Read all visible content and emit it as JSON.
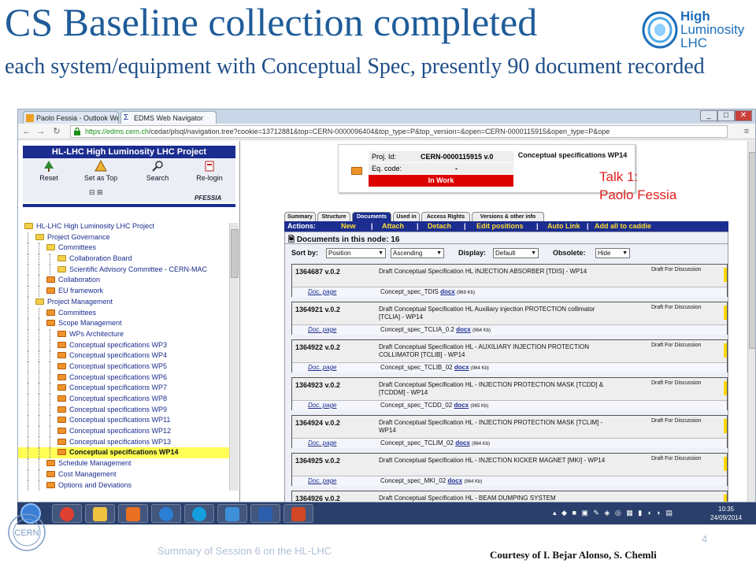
{
  "slide": {
    "title": "CS Baseline collection completed",
    "subtitle": "each system/equipment with Conceptual Spec, presently 90 document recorded",
    "logo_lines": [
      "High",
      "Luminosity",
      "LHC"
    ],
    "talk_line1": "Talk 1:",
    "talk_line2": "Paolo Fessia",
    "footer_left": "Summary of Session 6 on the HL-LHC",
    "page_number": "4",
    "courtesy": "Courtesy of  I. Bejar Alonso, S. Chemli"
  },
  "browser": {
    "tabs": [
      "Paolo Fessia - Outlook We",
      "EDMS Web Navigator"
    ],
    "url_host": "https://edms.cern.ch",
    "url_path": "/cedar/plsql/navigation.tree?cookie=13712881&top=CERN-0000096404&top_type=P&top_version=&open=CERN-0000115915&open_type=P&ope"
  },
  "left": {
    "header": "HL-LHC High Luminosity LHC Project",
    "tools": [
      "Reset",
      "Set as Top",
      "Search",
      "Re-login"
    ],
    "user": "PFESSIA",
    "tree": [
      {
        "label": "HL-LHC High Luminosity LHC Project",
        "color": "y",
        "indent": 0
      },
      {
        "label": "Project Governance",
        "color": "y",
        "indent": 1
      },
      {
        "label": "Committees",
        "color": "y",
        "indent": 2
      },
      {
        "label": "Collaboration Board",
        "color": "y",
        "indent": 3
      },
      {
        "label": "Scientific Advisory Committee - CERN-MAC",
        "color": "y",
        "indent": 3
      },
      {
        "label": "Collaboration",
        "color": "o",
        "indent": 2
      },
      {
        "label": "EU framework",
        "color": "o",
        "indent": 2
      },
      {
        "label": "Project Management",
        "color": "y",
        "indent": 1
      },
      {
        "label": "Committees",
        "color": "o",
        "indent": 2
      },
      {
        "label": "Scope Management",
        "color": "o",
        "indent": 2
      },
      {
        "label": "WPs Architecture",
        "color": "o",
        "indent": 3
      },
      {
        "label": "Conceptual specifications WP3",
        "color": "o",
        "indent": 3
      },
      {
        "label": "Conceptual specifications WP4",
        "color": "o",
        "indent": 3
      },
      {
        "label": "Conceptual specifications WP5",
        "color": "o",
        "indent": 3
      },
      {
        "label": "Conceptual specifications WP6",
        "color": "o",
        "indent": 3
      },
      {
        "label": "Conceptual specifications WP7",
        "color": "o",
        "indent": 3
      },
      {
        "label": "Conceptual specifications WP8",
        "color": "o",
        "indent": 3
      },
      {
        "label": "Conceptual specifications WP9",
        "color": "o",
        "indent": 3
      },
      {
        "label": "Conceptual specifications WP11",
        "color": "o",
        "indent": 3
      },
      {
        "label": "Conceptual specifications WP12",
        "color": "o",
        "indent": 3
      },
      {
        "label": "Conceptual specifications WP13",
        "color": "o",
        "indent": 3
      },
      {
        "label": "Conceptual specifications WP14",
        "color": "o",
        "indent": 3,
        "selected": true
      },
      {
        "label": "Schedule Management",
        "color": "o",
        "indent": 2
      },
      {
        "label": "Cost Management",
        "color": "o",
        "indent": 2
      },
      {
        "label": "Options and Deviations",
        "color": "o",
        "indent": 2
      }
    ]
  },
  "right": {
    "proj_id_label": "Proj. Id:",
    "proj_id_value": "CERN-0000115915  v.0",
    "eq_code_label": "Eq. code:",
    "eq_code_value": "-",
    "status": "In Work",
    "node_title": "Conceptual specifications WP14",
    "doc_tabs": [
      "Summary",
      "Structure",
      "Documents",
      "Used in",
      "Access Rights",
      "Versions & other info"
    ],
    "actions_label": "Actions:",
    "actions": [
      "New",
      "Attach",
      "Detach",
      "Edit positions",
      "Auto Link",
      "Add all to caddie"
    ],
    "docs_header": "Documents in this node: 16",
    "sort_by_label": "Sort by:",
    "sort_by_value": "Position",
    "sort_order_value": "Ascending",
    "display_label": "Display:",
    "display_value": "Default",
    "obsolete_label": "Obsolete:",
    "obsolete_value": "Hide",
    "documents": [
      {
        "id": "1364687 v.0.2",
        "title": "Draft Conceptual Specification HL INJECTION ABSORBER [TDIS] - WP14",
        "status": "Draft For Discussion",
        "file": "Concept_spec_TDIS",
        "size": "(969 Kb)"
      },
      {
        "id": "1364921 v.0.2",
        "title": "Draft Conceptual Specification HL Auxiliary injection PROTECTION collimator [TCLIA] - WP14",
        "status": "Draft For Discussion",
        "file": "Concept_spec_TCLIA_0.2",
        "size": "(964 Kb)"
      },
      {
        "id": "1364922 v.0.2",
        "title": "Draft Conceptual Specification HL - AUXILIARY INJECTION PROTECTION COLLIMATOR [TCLIB] - WP14",
        "status": "Draft For Discussion",
        "file": "Concept_spec_TCLIB_02",
        "size": "(964 Kb)"
      },
      {
        "id": "1364923 v.0.2",
        "title": "Draft Conceptual Specification HL - INJECTION PROTECTION MASK [TCDD] & [TCDDM] - WP14",
        "status": "Draft For Discussion",
        "file": "Concept_spec_TCDD_02",
        "size": "(965 Kb)"
      },
      {
        "id": "1364924 v.0.2",
        "title": "Draft Conceptual Specification HL - INJECTION PROTECTION MASK [TCLIM] - WP14",
        "status": "Draft For Discussion",
        "file": "Concept_spec_TCLIM_02",
        "size": "(964 Kb)"
      },
      {
        "id": "1364925 v.0.2",
        "title": "Draft Conceptual Specification HL - INJECTION KICKER MAGNET [MKI] - WP14",
        "status": "Draft For Discussion",
        "file": "Concept_spec_MKI_02",
        "size": "(964 Kb)"
      },
      {
        "id": "1364926 v.0.2",
        "title": "Draft Conceptual Specification HL - BEAM DUMPING SYSTEM",
        "status": "",
        "file": "",
        "size": ""
      }
    ],
    "doc_page_label": "Doc. page",
    "docx_label": "docx"
  },
  "taskbar": {
    "time": "10:35",
    "date": "24/09/2014"
  }
}
